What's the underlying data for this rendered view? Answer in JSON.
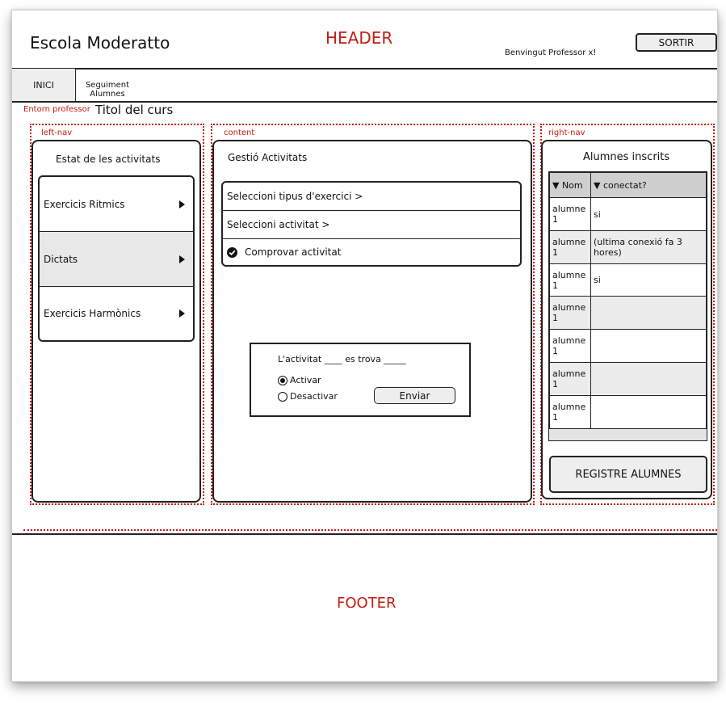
{
  "header": {
    "school_name": "Escola Moderatto",
    "header_label": "HEADER",
    "welcome": "Benvingut Professor x!",
    "logout_label": "SORTIR"
  },
  "menu": {
    "items": [
      {
        "label": "INICI"
      },
      {
        "label": "Seguiment\nAlumnes"
      }
    ]
  },
  "course": {
    "region_label": "Entorn professor",
    "title": "Titol del curs"
  },
  "left_nav": {
    "region_label": "left-nav",
    "heading": "Estat de les activitats",
    "items": [
      {
        "label": "Exercicis Ritmics"
      },
      {
        "label": "Dictats"
      },
      {
        "label": "Exercicis Harmònics"
      }
    ]
  },
  "content": {
    "region_label": "content",
    "heading": "Gestió Activitats",
    "steps": [
      {
        "label": "Seleccioni tipus d'exercici >"
      },
      {
        "label": "Seleccioni activitat >"
      },
      {
        "label": "Comprovar activitat"
      }
    ],
    "dialog": {
      "status_text": "L'activitat ____ es trova _____",
      "options": [
        {
          "label": "Activar",
          "selected": true
        },
        {
          "label": "Desactivar",
          "selected": false
        }
      ],
      "submit_label": "Enviar"
    }
  },
  "right_nav": {
    "region_label": "right-nav",
    "heading": "Alumnes inscrits",
    "columns": [
      "▼ Nom",
      "▼ conectat?"
    ],
    "rows": [
      {
        "name": "alumne 1",
        "status": "si"
      },
      {
        "name": "alumne 1",
        "status": "(ultima conexió fa 3 hores)"
      },
      {
        "name": "alumne 1",
        "status": "si"
      },
      {
        "name": "alumne 1",
        "status": ""
      },
      {
        "name": "alumne 1",
        "status": ""
      },
      {
        "name": "alumne 1",
        "status": ""
      },
      {
        "name": "alumne 1",
        "status": ""
      }
    ],
    "register_label": "REGISTRE ALUMNES"
  },
  "footer": {
    "label": "FOOTER"
  },
  "colors": {
    "annotation_red": "#c41d12",
    "stroke": "#222222",
    "selected_fill": "#e8e8e8",
    "table_header": "#cfcfcf",
    "shaded_row": "#ececec"
  }
}
